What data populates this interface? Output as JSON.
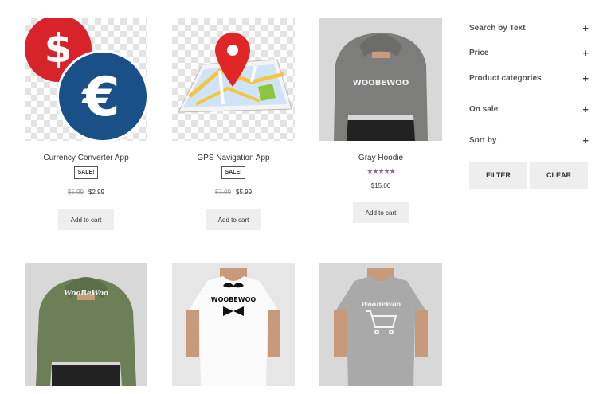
{
  "products": [
    {
      "name": "Currency Converter App",
      "badge": "SALE!",
      "old_price": "$5.99",
      "price": "$2.99",
      "cart": "Add to cart"
    },
    {
      "name": "GPS Navigation App",
      "badge": "SALE!",
      "old_price": "$7.99",
      "price": "$5.99",
      "cart": "Add to cart"
    },
    {
      "name": "Gray Hoodie",
      "rating": "★★★★★",
      "price": "$15.00",
      "cart": "Add to cart",
      "print": "WOOBEWOO"
    },
    {
      "print": "WooBeWoo"
    },
    {
      "print": "WOOBEWOO"
    },
    {
      "print": "WooBeWoo"
    }
  ],
  "filters": {
    "items": [
      "Search by Text",
      "Price",
      "Product categories",
      "On sale",
      "Sort by"
    ],
    "toggle_symbol": "+",
    "filter_label": "FILTER",
    "clear_label": "CLEAR"
  },
  "colors": {
    "rating": "#8c6a9a",
    "button_bg": "#eeeeee",
    "dollar_red": "#d9232a",
    "euro_blue": "#1a5088"
  }
}
